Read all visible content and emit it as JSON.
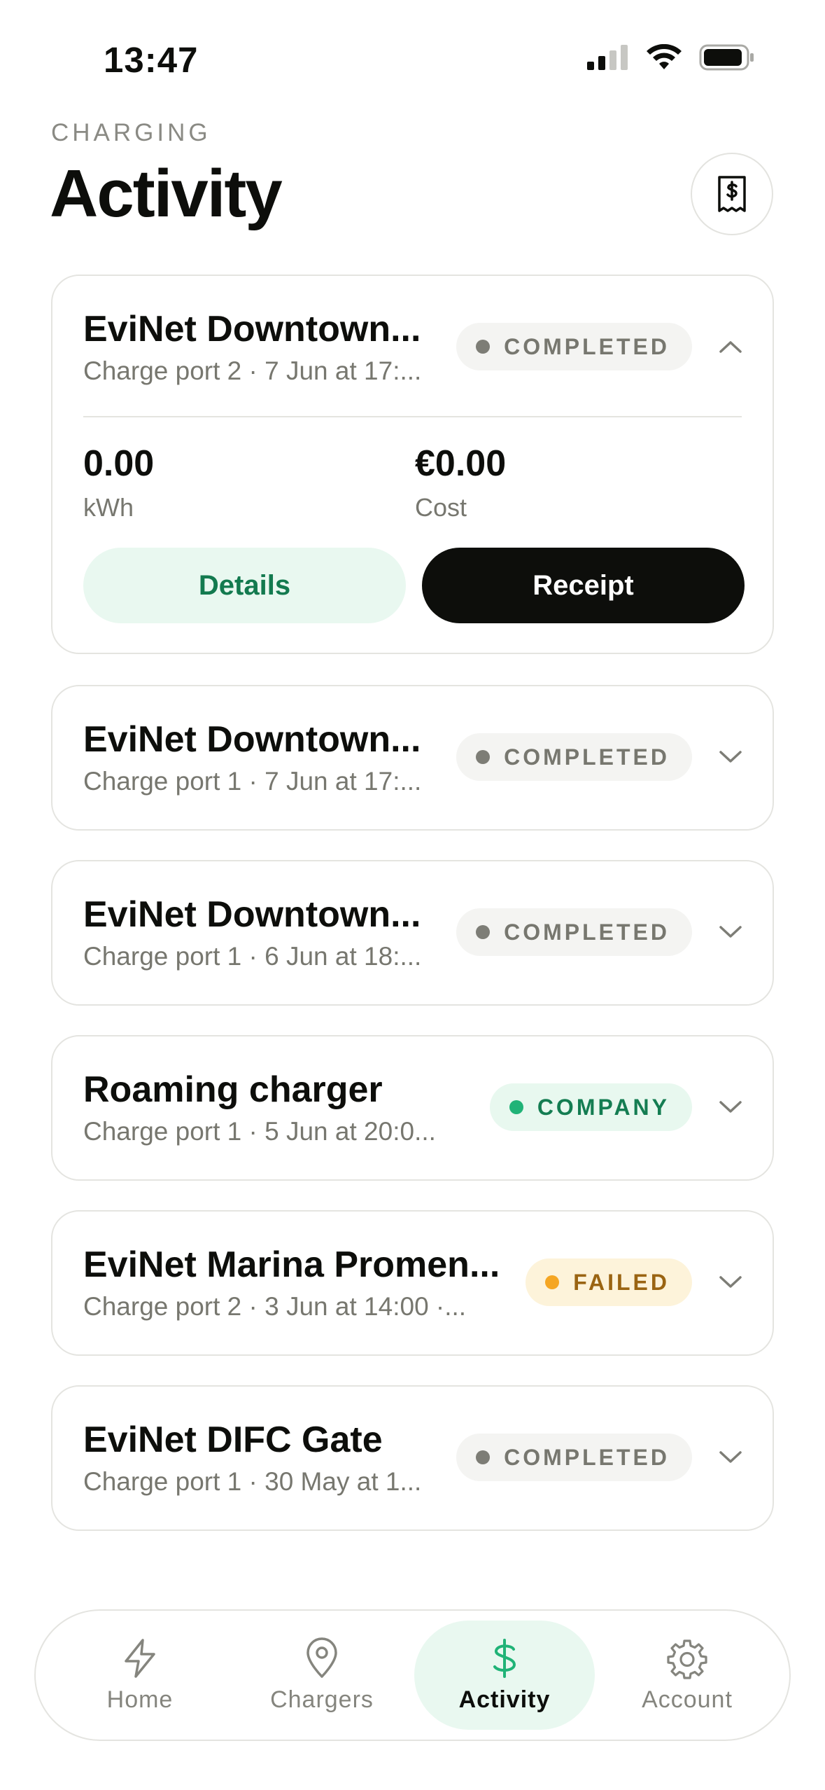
{
  "status_bar": {
    "time": "13:47"
  },
  "header": {
    "eyebrow": "CHARGING",
    "title": "Activity"
  },
  "sessions": [
    {
      "title": "EviNet Downtown...",
      "subtitle": "Charge port 2 · 7 Jun at 17:...",
      "status": "COMPLETED",
      "expanded": true,
      "energy_value": "0.00",
      "energy_label": "kWh",
      "cost_value": "€0.00",
      "cost_label": "Cost",
      "details_label": "Details",
      "receipt_label": "Receipt"
    },
    {
      "title": "EviNet Downtown...",
      "subtitle": "Charge port 1 · 7 Jun at 17:...",
      "status": "COMPLETED"
    },
    {
      "title": "EviNet Downtown...",
      "subtitle": "Charge port 1 · 6 Jun at 18:...",
      "status": "COMPLETED"
    },
    {
      "title": "Roaming charger",
      "subtitle": "Charge port 1 · 5 Jun at 20:0...",
      "status": "COMPANY"
    },
    {
      "title": "EviNet Marina Promen...",
      "subtitle": "Charge port 2 · 3 Jun at 14:00 ·...",
      "status": "FAILED"
    },
    {
      "title": "EviNet DIFC Gate",
      "subtitle": "Charge port 1 · 30 May at 1...",
      "status": "COMPLETED"
    }
  ],
  "nav": {
    "tabs": [
      {
        "label": "Home",
        "icon": "bolt-icon"
      },
      {
        "label": "Chargers",
        "icon": "map-pin-icon"
      },
      {
        "label": "Activity",
        "icon": "dollar-icon",
        "active": true
      },
      {
        "label": "Account",
        "icon": "gear-icon"
      }
    ]
  },
  "colors": {
    "accent": "#20b377",
    "accent_bg": "#e9f8f0",
    "failed": "#f5a623",
    "text": "#0d0e0b"
  }
}
